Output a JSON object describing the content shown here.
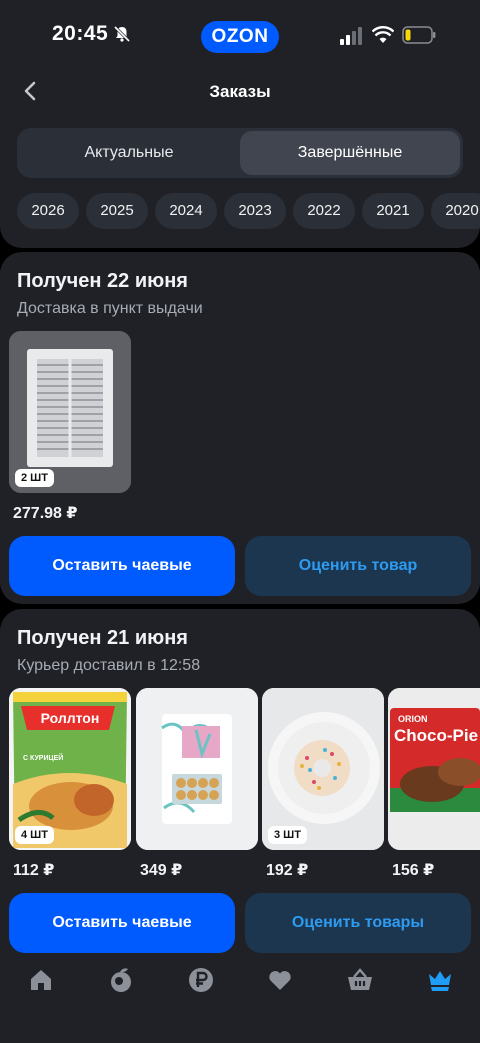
{
  "status_bar": {
    "time": "20:45",
    "logo": "OZON"
  },
  "header": {
    "title": "Заказы",
    "back_icon": "chevron-left-icon"
  },
  "tabs": [
    {
      "label": "Актуальные",
      "active": false
    },
    {
      "label": "Завершённые",
      "active": true
    }
  ],
  "years": [
    "2026",
    "2025",
    "2024",
    "2023",
    "2022",
    "2021",
    "2020"
  ],
  "orders": [
    {
      "title": "Получен 22 июня",
      "subtitle": "Доставка в пункт выдачи",
      "items": [
        {
          "qty": "2 ШТ",
          "price": "277.98 ₽",
          "image": "ventilation-grille"
        }
      ],
      "tip_button": "Оставить чаевые",
      "rate_button": "Оценить товар"
    },
    {
      "title": "Получен 21 июня",
      "subtitle": "Курьер доставил в 12:58",
      "items": [
        {
          "qty": "4 ШТ",
          "price": "112 ₽",
          "image": "noodle-pack",
          "brand": "Роллтон",
          "caption": "С КУРИЦЕЙ"
        },
        {
          "qty": "",
          "price": "349 ₽",
          "image": "snack-box"
        },
        {
          "qty": "3 ШТ",
          "price": "192 ₽",
          "image": "donut"
        },
        {
          "qty": "",
          "price": "156 ₽",
          "image": "choco-pie",
          "brand_top": "ORION",
          "brand": "Choco-Pie"
        }
      ],
      "tip_button": "Оставить чаевые",
      "rate_button": "Оценить товары"
    }
  ],
  "bottom_nav": [
    {
      "icon": "home-icon"
    },
    {
      "icon": "fresh-icon"
    },
    {
      "icon": "ruble-icon"
    },
    {
      "icon": "heart-icon"
    },
    {
      "icon": "basket-icon"
    },
    {
      "icon": "crown-icon",
      "active": true
    }
  ],
  "colors": {
    "background": "#000000",
    "surface": "#1f2127",
    "chip": "#2b2f37",
    "accent_blue": "#005bff",
    "secondary_button": "#1c3650",
    "secondary_text": "#2d9bf0",
    "active_nav": "#1f9cf6"
  }
}
